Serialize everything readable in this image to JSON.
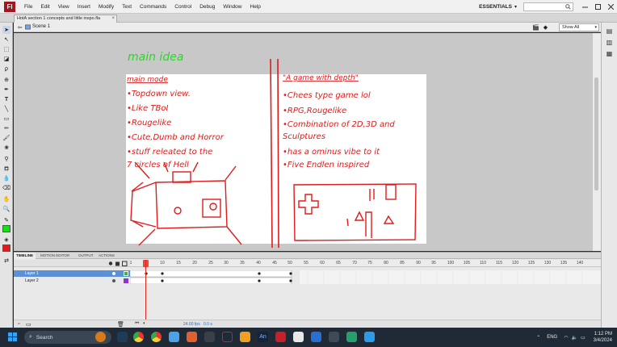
{
  "app": {
    "logo_text": "Fl"
  },
  "menu": {
    "items": [
      "File",
      "Edit",
      "View",
      "Insert",
      "Modify",
      "Text",
      "Commands",
      "Control",
      "Debug",
      "Window",
      "Help"
    ],
    "workspace": "ESSENTIALS",
    "workspace_caret": "▾"
  },
  "document": {
    "tab_title": "HotA section 1 concepts and little inspo.fla",
    "close_glyph": "×"
  },
  "editbar": {
    "scene": "Scene 1",
    "zoom": "Show All",
    "zoom_caret": "▾"
  },
  "stage_sketch": {
    "title": "main idea",
    "left_column": {
      "heading": "main mode",
      "bullets": [
        "•Topdown view.",
        "•Like TBoI",
        "•Rougelike",
        "•Cute,Dumb and Horror",
        "•stuff releated to the",
        "7 circles of Hell"
      ]
    },
    "right_column": {
      "heading": "\"A game with depth\"",
      "bullets": [
        "•Chees type game lol",
        "•RPG,Rougelike",
        "•Combination of 2D,3D and",
        "Sculptures",
        "•has a ominus vibe to it",
        "•Five Endlen inspired"
      ]
    },
    "ink_color": "#e01b1b",
    "title_color": "#2fd22f"
  },
  "timeline": {
    "tabs": [
      "TIMELINE",
      "MOTION EDITOR",
      "OUTPUT",
      "ACTIONS"
    ],
    "ruler": [
      "1",
      "5",
      "10",
      "15",
      "20",
      "25",
      "30",
      "35",
      "40",
      "45",
      "50",
      "55",
      "60",
      "65",
      "70",
      "75",
      "80",
      "85",
      "90",
      "95",
      "100",
      "105",
      "110",
      "115",
      "120",
      "125",
      "130",
      "135",
      "140"
    ],
    "layers": [
      {
        "name": "Layer 1",
        "selected": true,
        "color": "#2fbf2f"
      },
      {
        "name": "Layer 2",
        "selected": false,
        "color": "#8e34c9"
      }
    ],
    "footer": {
      "fps": "24.00 fps",
      "time": "0.0 s"
    }
  },
  "taskbar": {
    "search_label": "Search",
    "tray_lang": "ENG",
    "time": "1:12 PM",
    "date": "3/4/2024"
  }
}
